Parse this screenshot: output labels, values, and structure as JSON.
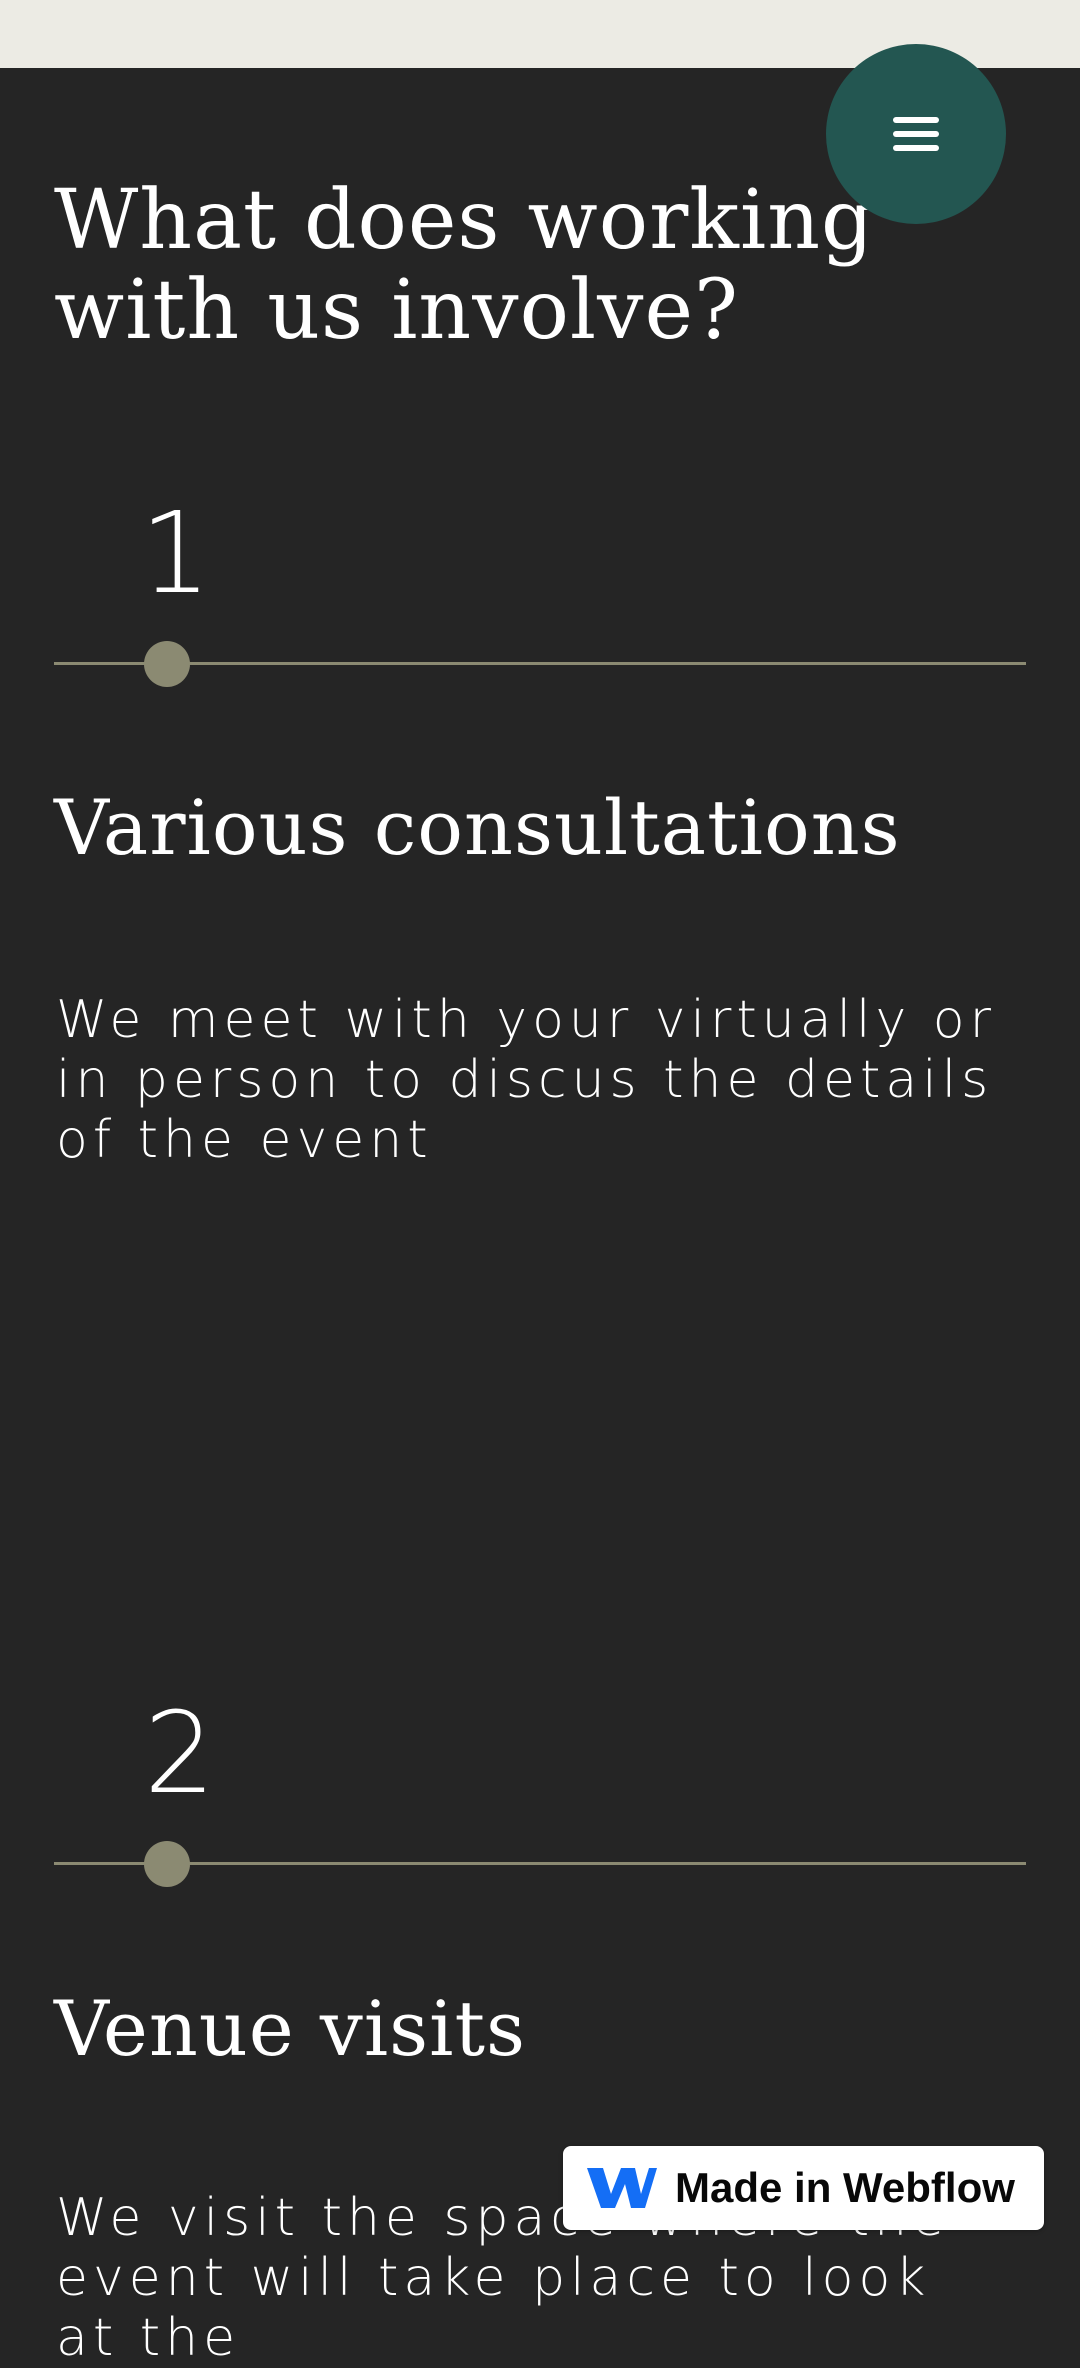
{
  "header": {
    "menu_icon": "hamburger-menu-icon"
  },
  "section": {
    "title": "What does working with us involve?"
  },
  "steps": [
    {
      "number": "1",
      "title": "Various consultations",
      "description": "We meet with your virtually or in person to discus the details of the event"
    },
    {
      "number": "2",
      "title": "Venue visits",
      "description": "We visit the space where the event will take place to look at the"
    }
  ],
  "badge": {
    "label": "Made in Webflow",
    "icon": "webflow-logo-icon"
  },
  "colors": {
    "top_strip": "#ecebe4",
    "background": "#252525",
    "menu_button": "#235651",
    "timeline": "#8b8a72",
    "webflow_blue": "#146ef5"
  }
}
